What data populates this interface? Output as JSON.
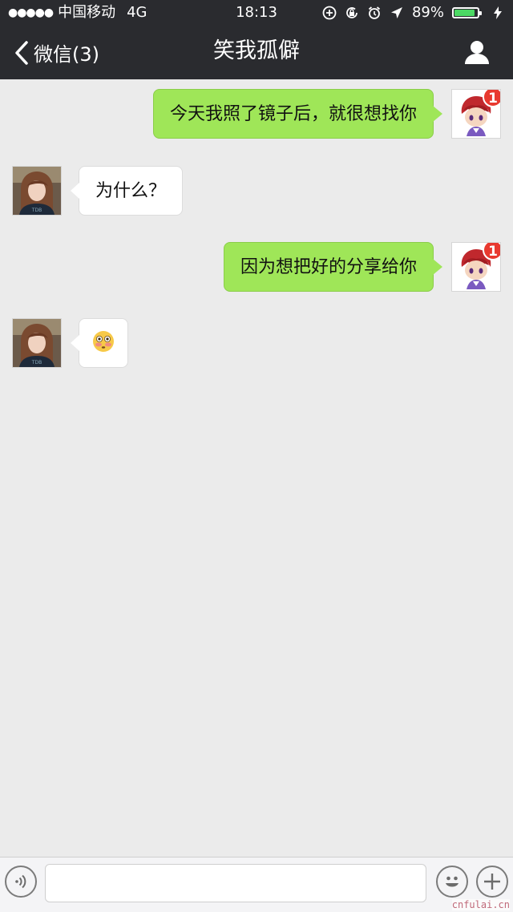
{
  "status_bar": {
    "carrier": "中国移动",
    "network": "4G",
    "time": "18:13",
    "battery_percent": "89%",
    "battery_level": 0.89
  },
  "nav": {
    "back_label": "微信(3)",
    "title": "笑我孤僻"
  },
  "messages": [
    {
      "sender": "me",
      "text": "今天我照了镜子后，就很想找你",
      "avatar_badge": "1"
    },
    {
      "sender": "other",
      "text": "为什么？"
    },
    {
      "sender": "me",
      "text": "因为想把好的分享给你",
      "avatar_badge": "1"
    },
    {
      "sender": "other",
      "text": "😳"
    }
  ],
  "input": {
    "placeholder": ""
  },
  "watermark": "cnfulai.cn",
  "colors": {
    "nav_bg": "#2a2b2f",
    "chat_bg": "#ebebeb",
    "outgoing_bubble": "#9fe658",
    "incoming_bubble": "#ffffff",
    "badge": "#e8392f",
    "battery_fill": "#4cd964"
  }
}
